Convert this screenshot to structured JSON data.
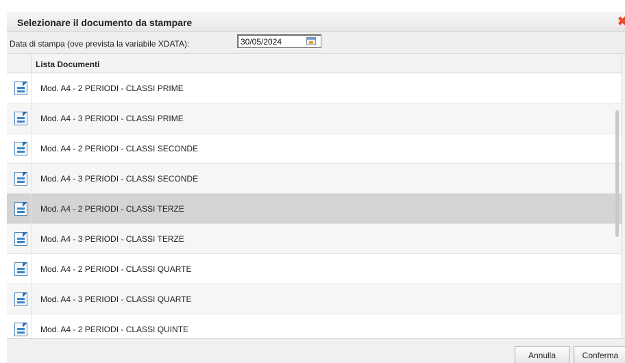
{
  "dialog": {
    "title": "Selezionare il documento da stampare",
    "close_icon": "close-icon"
  },
  "print_date": {
    "label": "Data di stampa (ove prevista la variabile XDATA):",
    "value": "30/05/2024",
    "icon": "calendar-icon"
  },
  "documents": {
    "column_header": "Lista Documenti",
    "row_icon": "document-icon",
    "selected_index": 4,
    "items": [
      {
        "label": "Mod. A4 - 2 PERIODI - CLASSI PRIME"
      },
      {
        "label": "Mod. A4 - 3 PERIODI - CLASSI PRIME"
      },
      {
        "label": "Mod. A4 - 2 PERIODI - CLASSI SECONDE"
      },
      {
        "label": "Mod. A4 - 3 PERIODI - CLASSI SECONDE"
      },
      {
        "label": "Mod. A4 - 2 PERIODI - CLASSI TERZE"
      },
      {
        "label": "Mod. A4 - 3 PERIODI - CLASSI TERZE"
      },
      {
        "label": "Mod. A4 - 2 PERIODI - CLASSI QUARTE"
      },
      {
        "label": "Mod. A4 - 3 PERIODI - CLASSI QUARTE"
      },
      {
        "label": "Mod. A4 - 2 PERIODI - CLASSI QUINTE"
      }
    ]
  },
  "footer": {
    "cancel_label": "Annulla",
    "confirm_label": "Conferma"
  },
  "colors": {
    "close_icon": "#e84b2c",
    "selected_row": "#d4d4d4",
    "doc_icon": "#3a86c8"
  }
}
